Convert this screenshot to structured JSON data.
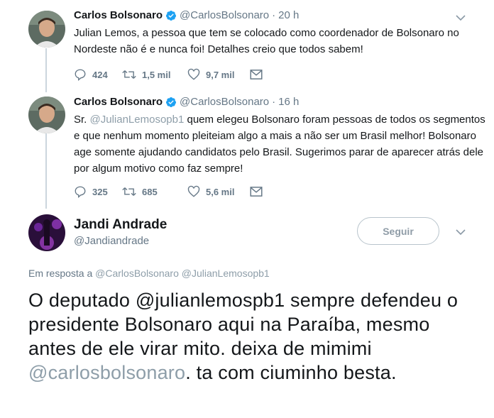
{
  "tweets": [
    {
      "name": "Carlos Bolsonaro",
      "handle": "@CarlosBolsonaro",
      "dot": "·",
      "time": "20 h",
      "text": "Julian Lemos, a pessoa que tem se colocado como coordenador de Bolsonaro no Nordeste não é e nunca foi! Detalhes creio que todos sabem!",
      "replies": "424",
      "retweets": "1,5 mil",
      "likes": "9,7 mil"
    },
    {
      "name": "Carlos Bolsonaro",
      "handle": "@CarlosBolsonaro",
      "dot": "·",
      "time": "16 h",
      "text_prefix": "Sr. ",
      "text_mention": "@JulianLemosopb1",
      "text_rest": " quem elegeu Bolsonaro foram pessoas de todos os segmentos e que nenhum momento pleiteiam algo a mais a não ser um Brasil melhor! Bolsonaro age somente ajudando candidatos pelo Brasil. Sugerimos parar de aparecer atrás dele por algum motivo como faz sempre!",
      "replies": "325",
      "retweets": "685",
      "likes": "5,6 mil"
    }
  ],
  "main_tweet": {
    "name": "Jandi Andrade",
    "handle": "@Jandiandrade",
    "follow_label": "Seguir",
    "reply_prefix": "Em resposta a ",
    "reply_mention_1": "@CarlosBolsonaro",
    "reply_mention_2": "@JulianLemosopb1",
    "text_part1": "O deputado @julianlemospb1 sempre defendeu o presidente Bolsonaro aqui na Paraíba, mesmo antes de ele virar mito. deixa de mimimi ",
    "text_mention": "@carlosbolsonaro",
    "text_part2": ". ta com ciuminho besta."
  },
  "colors": {
    "verified": "#1da1f2",
    "secondary_text": "#657786",
    "thread_line": "#ccd6dd",
    "mention_faded": "#8e9ea9"
  },
  "icons": [
    "verified-badge-icon",
    "chevron-down-icon",
    "reply-icon",
    "retweet-icon",
    "like-icon",
    "message-icon"
  ]
}
